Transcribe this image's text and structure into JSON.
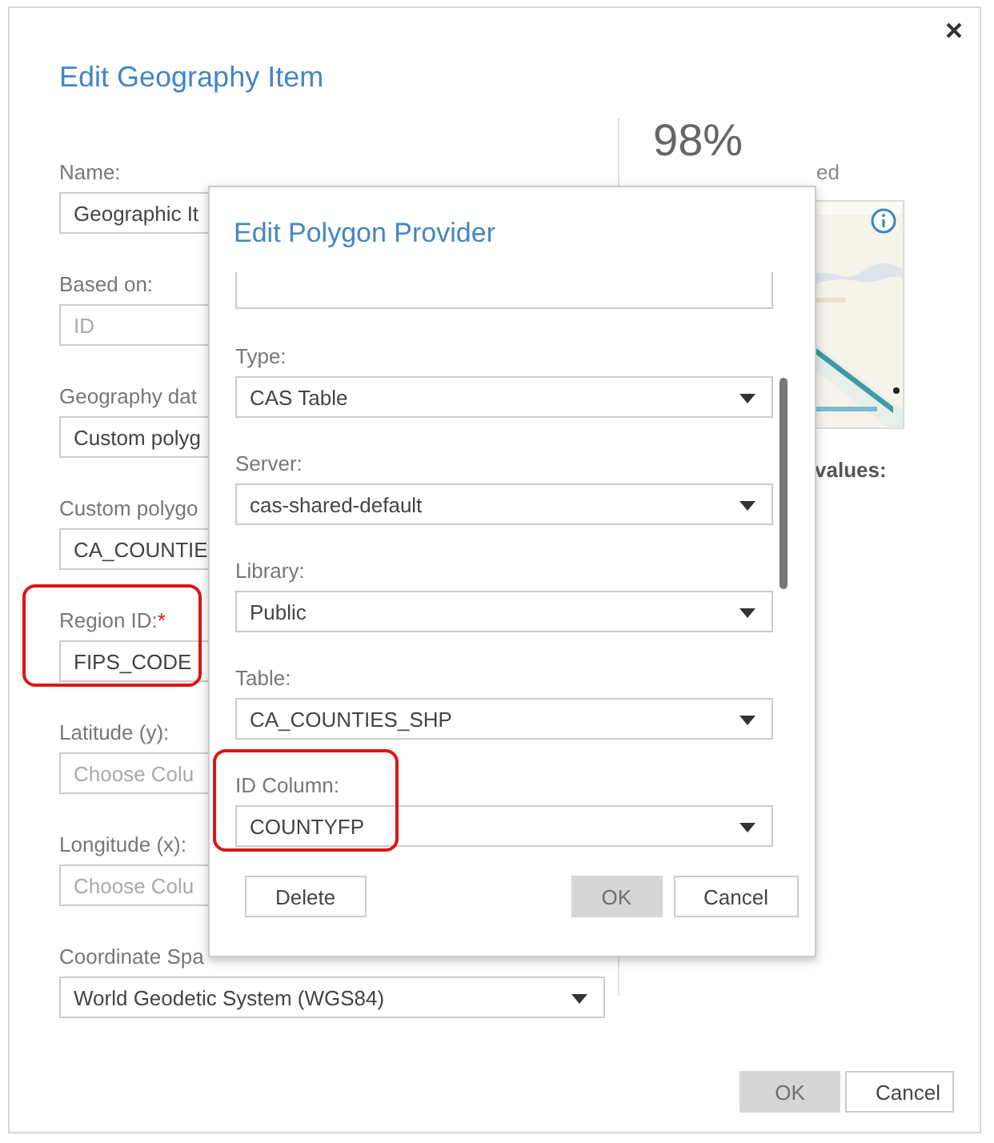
{
  "dialog": {
    "title": "Edit Geography Item",
    "fields": [
      {
        "label": "Name:",
        "value": "Geographic It",
        "kind": "text",
        "highlighted": false
      },
      {
        "label": "Based on:",
        "placeholder": "ID",
        "kind": "text",
        "highlighted": false
      },
      {
        "label": "Geography dat",
        "value": "Custom polyg",
        "kind": "text",
        "highlighted": false
      },
      {
        "label": "Custom polygo",
        "value": "CA_COUNTIE",
        "kind": "text",
        "highlighted": false
      },
      {
        "label": "Region ID:",
        "required_mark": "*",
        "value": "FIPS_CODE",
        "kind": "text",
        "highlighted": true
      },
      {
        "label": "Latitude (y):",
        "placeholder": "Choose Colu",
        "kind": "text",
        "highlighted": false
      },
      {
        "label": "Longitude (x):",
        "placeholder": "Choose Colu",
        "kind": "text",
        "highlighted": false
      },
      {
        "label": "Coordinate Spa",
        "value": "World Geodetic System (WGS84)",
        "kind": "select",
        "highlighted": false
      }
    ],
    "summary": {
      "percent": "98%",
      "caption": "ed",
      "values_label": "values:"
    },
    "buttons": [
      {
        "label": "OK",
        "disabled": true
      },
      {
        "label": "Cancel",
        "disabled": false
      }
    ]
  },
  "provider_dialog": {
    "title": "Edit Polygon Provider",
    "fields": [
      {
        "kind": "cut"
      },
      {
        "label": "Type:",
        "value": "CAS Table",
        "kind": "select",
        "highlighted": false
      },
      {
        "label": "Server:",
        "value": "cas-shared-default",
        "kind": "select",
        "highlighted": false
      },
      {
        "label": "Library:",
        "value": "Public",
        "kind": "select",
        "highlighted": false
      },
      {
        "label": "Table:",
        "value": "CA_COUNTIES_SHP",
        "kind": "select",
        "highlighted": false
      },
      {
        "label": "ID Column:",
        "value": "COUNTYFP",
        "kind": "select",
        "highlighted": true
      }
    ],
    "buttons": [
      {
        "label": "Delete",
        "disabled": false,
        "kind": "left"
      },
      {
        "label": "OK",
        "disabled": true,
        "kind": "right"
      },
      {
        "label": "Cancel",
        "disabled": false,
        "kind": "right"
      }
    ]
  }
}
